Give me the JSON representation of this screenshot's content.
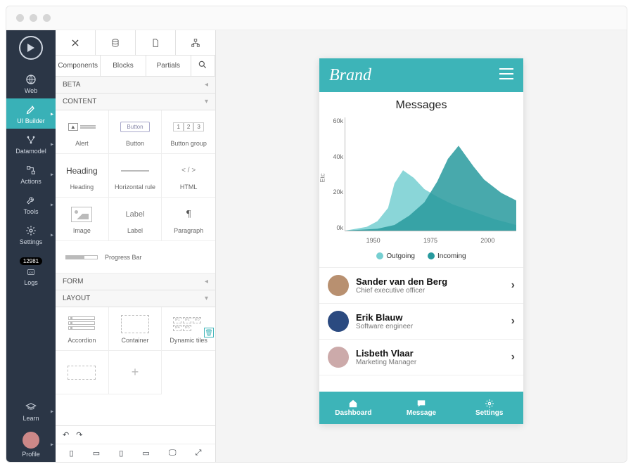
{
  "colors": {
    "accent": "#3db4b8",
    "darknav": "#2b3646",
    "series_a": "#76cfd1",
    "series_b": "#289a9e"
  },
  "railnav": {
    "badge": "12981",
    "items": [
      {
        "id": "web",
        "label": "Web",
        "icon": "globe-icon"
      },
      {
        "id": "uibuilder",
        "label": "UI Builder",
        "icon": "pencil-ruler-icon",
        "active": true
      },
      {
        "id": "datamodel",
        "label": "Datamodel",
        "icon": "nodes-icon"
      },
      {
        "id": "actions",
        "label": "Actions",
        "icon": "flow-icon"
      },
      {
        "id": "tools",
        "label": "Tools",
        "icon": "wrench-icon"
      },
      {
        "id": "settings",
        "label": "Settings",
        "icon": "gear-icon"
      },
      {
        "id": "logs",
        "label": "Logs",
        "icon": "log-icon"
      },
      {
        "id": "learn",
        "label": "Learn",
        "icon": "graduation-icon"
      },
      {
        "id": "profile",
        "label": "Profile",
        "icon": "avatar-icon"
      }
    ]
  },
  "builder": {
    "toptabs": [
      "Components",
      "Blocks",
      "Partials"
    ],
    "sections": {
      "beta": "BETA",
      "content": "CONTENT",
      "form": "FORM",
      "layout": "LAYOUT"
    },
    "content_tiles": [
      "Alert",
      "Button",
      "Button group",
      "Heading",
      "Horizontal rule",
      "HTML",
      "Image",
      "Label",
      "Paragraph",
      "Progress Bar"
    ],
    "layout_tiles": [
      "Accordion",
      "Container",
      "Dynamic tiles"
    ],
    "button_preview_label": "Button",
    "btngrp_preview": [
      "1",
      "2",
      "3"
    ],
    "heading_preview": "Heading",
    "html_preview": "< / >",
    "label_preview": "Label",
    "paragraph_preview": "¶"
  },
  "phone": {
    "brand": "Brand",
    "title": "Messages",
    "legend": {
      "a": "Outgoing",
      "b": "Incoming"
    },
    "tabs": [
      "Dashboard",
      "Message",
      "Settings"
    ],
    "contacts": [
      {
        "name": "Sander van den Berg",
        "role": "Chief executive officer"
      },
      {
        "name": "Erik Blauw",
        "role": "Software engineer"
      },
      {
        "name": "Lisbeth Vlaar",
        "role": "Marketing Manager"
      }
    ]
  },
  "chart_data": {
    "type": "area",
    "title": "Messages",
    "xlabel": "",
    "ylabel": "Etc",
    "x_ticks": [
      "1950",
      "1975",
      "2000"
    ],
    "y_ticks": [
      "60k",
      "40k",
      "20k",
      "0k"
    ],
    "ylim": [
      0,
      60
    ],
    "xlim": [
      1935,
      2015
    ],
    "series": [
      {
        "name": "Outgoing",
        "color": "#76cfd1",
        "x": [
          1935,
          1945,
          1950,
          1955,
          1958,
          1962,
          1967,
          1972,
          1978,
          1985,
          1995,
          2005,
          2015
        ],
        "values": [
          0,
          2,
          5,
          12,
          25,
          32,
          28,
          22,
          18,
          14,
          10,
          6,
          3
        ]
      },
      {
        "name": "Incoming",
        "color": "#289a9e",
        "x": [
          1935,
          1950,
          1958,
          1965,
          1972,
          1978,
          1983,
          1988,
          1995,
          2000,
          2008,
          2015
        ],
        "values": [
          0,
          1,
          3,
          8,
          15,
          26,
          38,
          45,
          34,
          27,
          20,
          16
        ]
      }
    ]
  }
}
